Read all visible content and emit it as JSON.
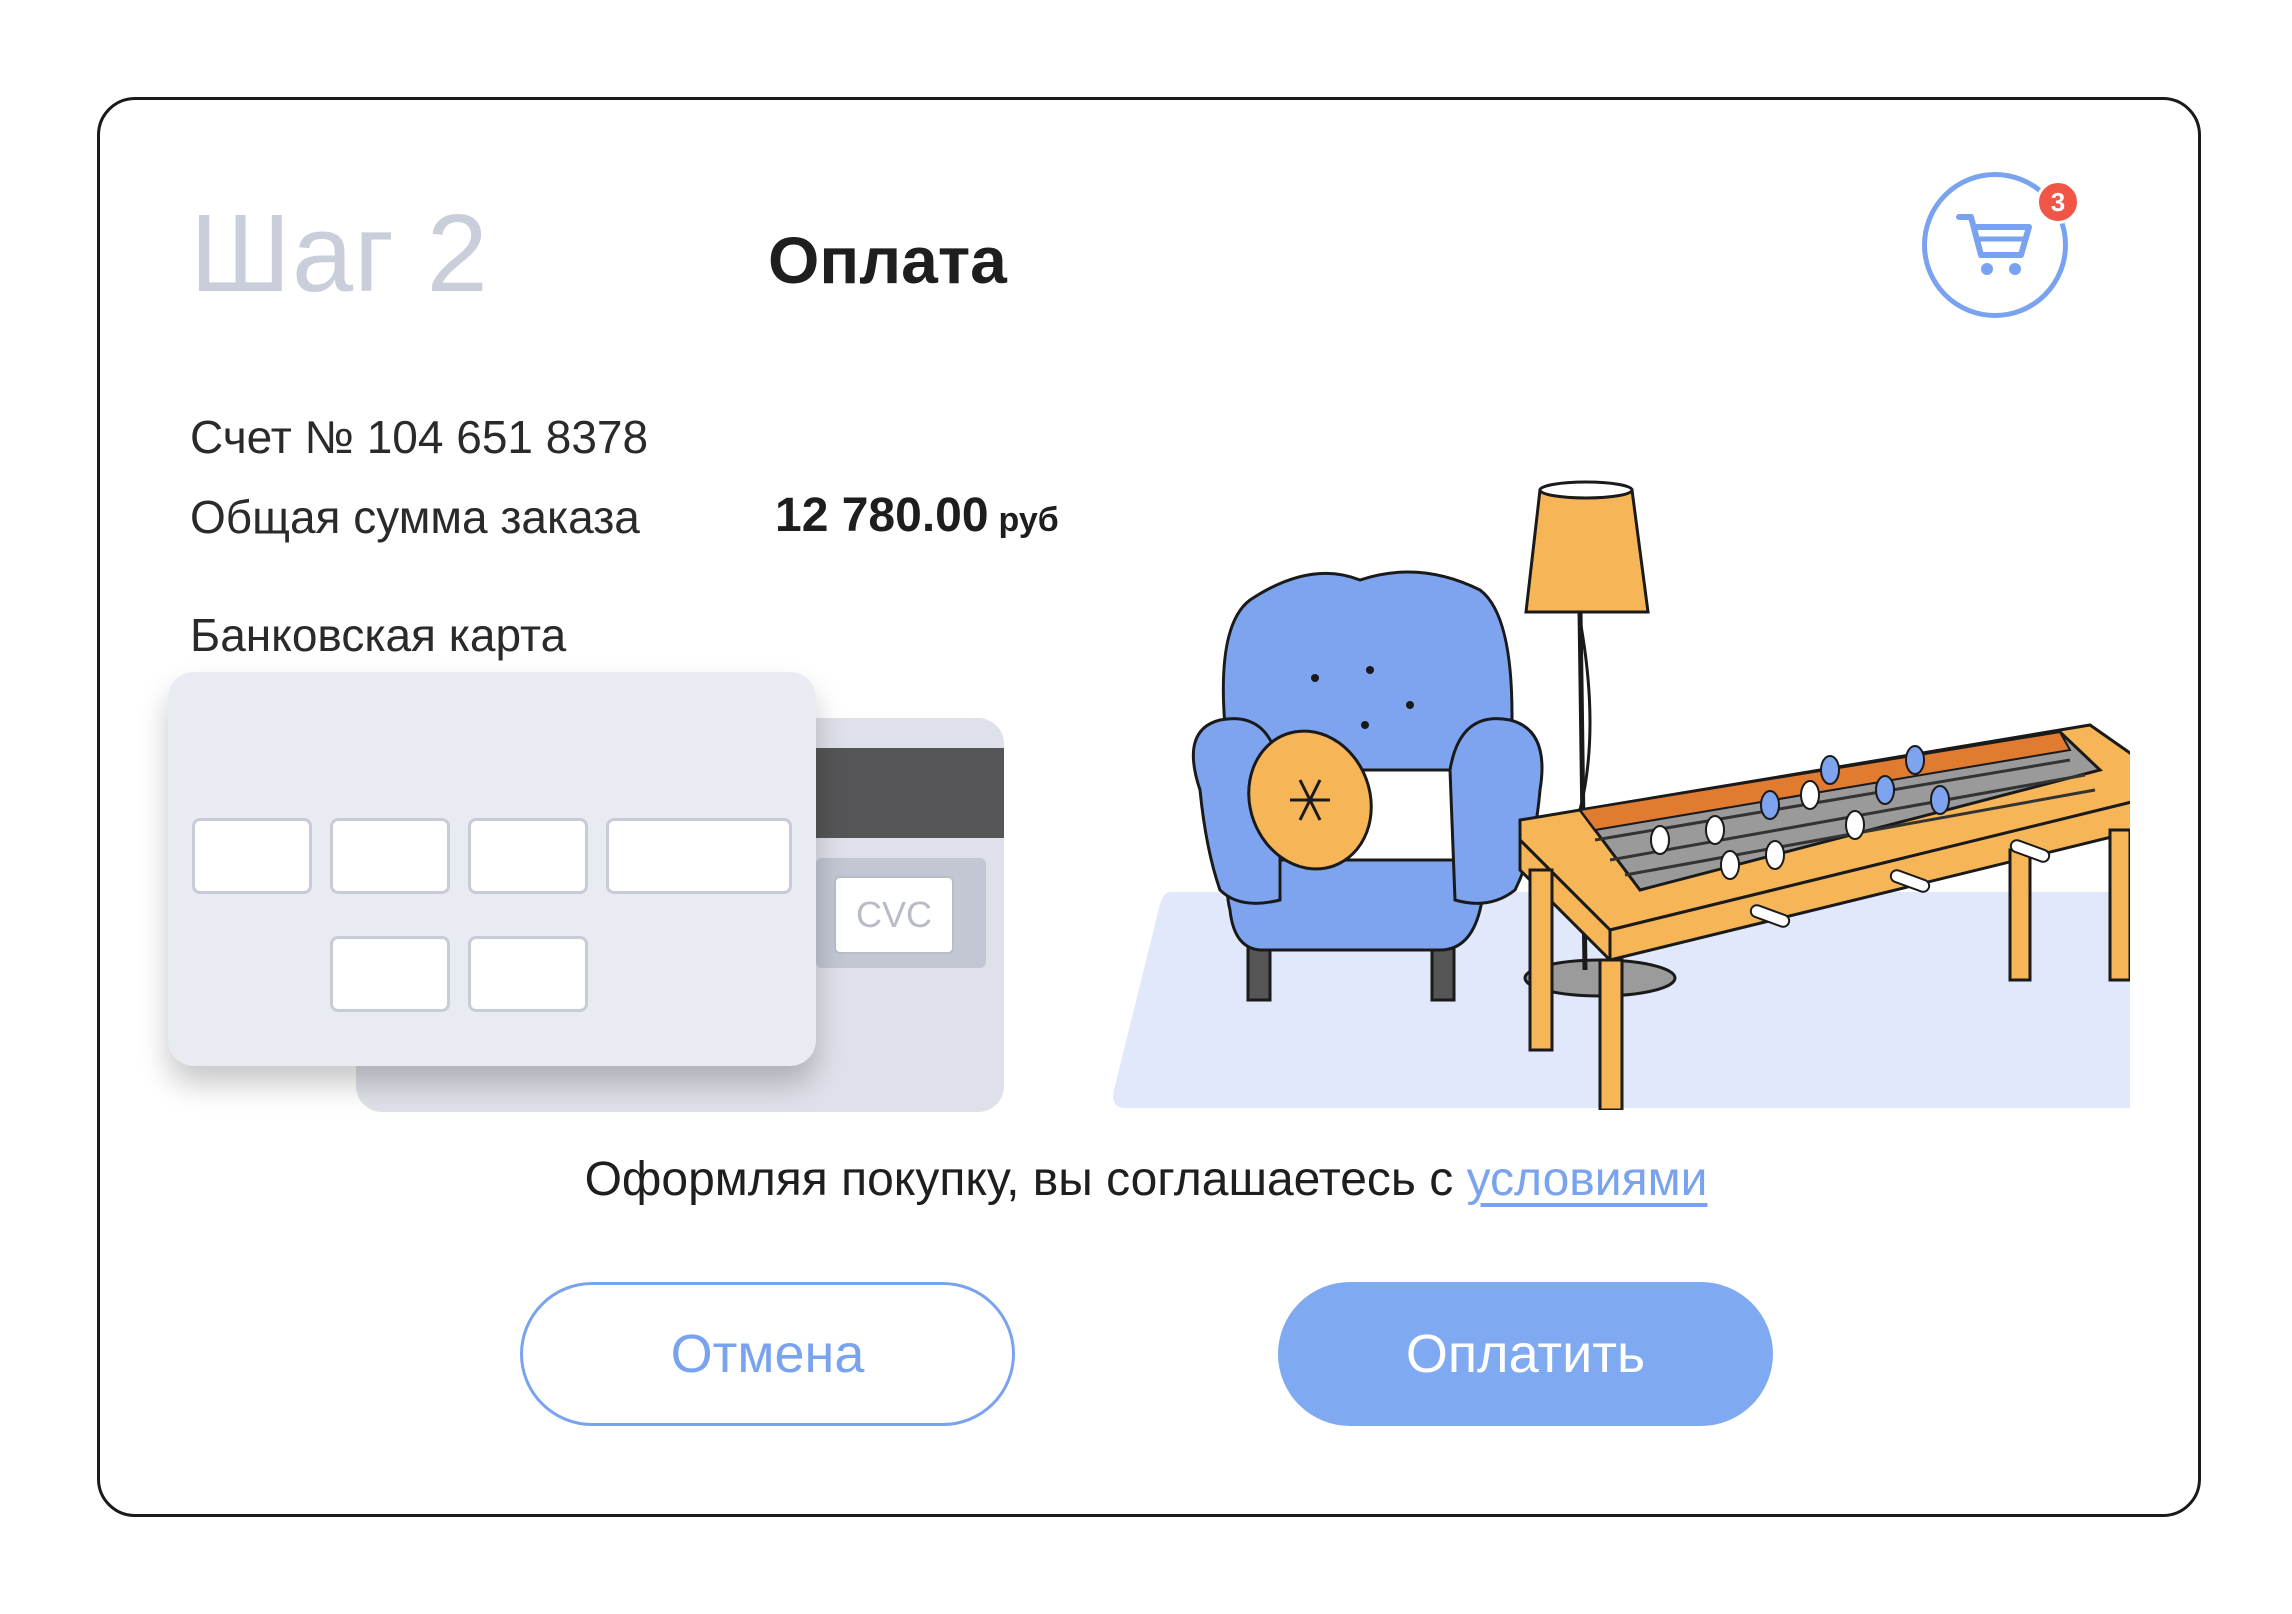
{
  "header": {
    "step": "Шаг 2",
    "title": "Оплата",
    "cart_count": "3"
  },
  "order": {
    "invoice": "Счет № 104 651 8378",
    "total_label": "Общая сумма заказа",
    "total_value": "12 780.00",
    "total_currency": "руб"
  },
  "payment": {
    "method_label": "Банковская карта",
    "cvc_placeholder": "CVC"
  },
  "footer": {
    "agree_text": "Оформляя покупку, вы соглашаетесь с ",
    "agree_link": "условиями",
    "cancel_label": "Отмена",
    "pay_label": "Оплатить"
  },
  "colors": {
    "accent": "#7aa3ef",
    "pay_button": "#7fa9f0",
    "badge": "#f05545",
    "step_text": "#c9ceda"
  },
  "icons": [
    "cart-icon"
  ]
}
